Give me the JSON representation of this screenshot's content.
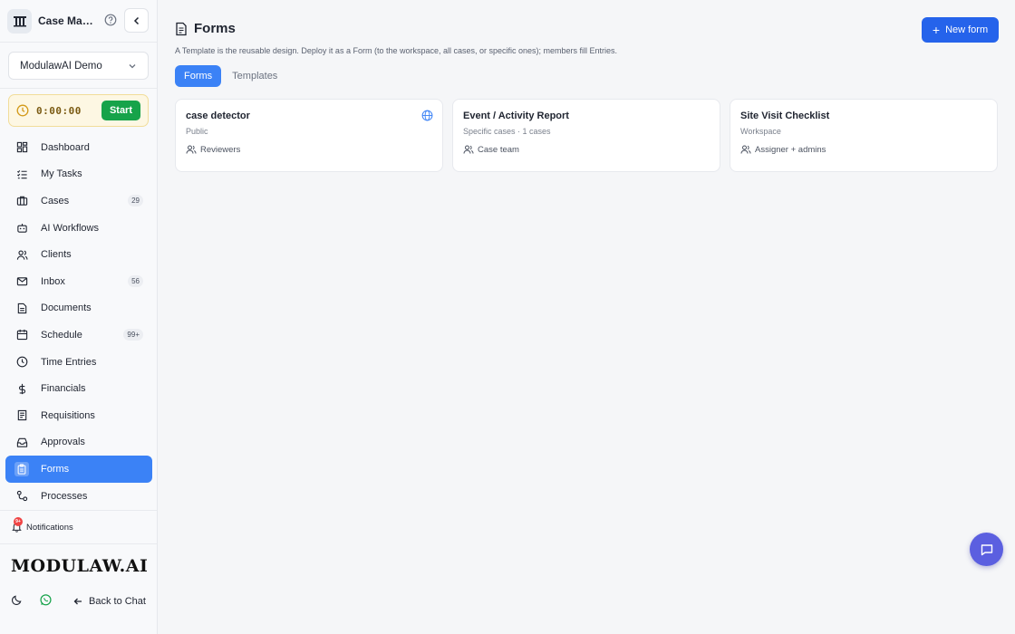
{
  "sidebar": {
    "brand_name": "Case Man...",
    "workspace": "ModulawAI Demo",
    "timer": {
      "time": "0:00:00",
      "start_label": "Start"
    },
    "nav": [
      {
        "label": "Dashboard",
        "icon": "dashboard-icon",
        "badge": ""
      },
      {
        "label": "My Tasks",
        "icon": "tasks-icon",
        "badge": ""
      },
      {
        "label": "Cases",
        "icon": "briefcase-icon",
        "badge": "29"
      },
      {
        "label": "AI Workflows",
        "icon": "robot-icon",
        "badge": ""
      },
      {
        "label": "Clients",
        "icon": "users-icon",
        "badge": ""
      },
      {
        "label": "Inbox",
        "icon": "mail-icon",
        "badge": "56"
      },
      {
        "label": "Documents",
        "icon": "document-icon",
        "badge": ""
      },
      {
        "label": "Schedule",
        "icon": "calendar-icon",
        "badge": "99+"
      },
      {
        "label": "Time Entries",
        "icon": "clock-icon",
        "badge": ""
      },
      {
        "label": "Financials",
        "icon": "dollar-icon",
        "badge": ""
      },
      {
        "label": "Requisitions",
        "icon": "receipt-icon",
        "badge": ""
      },
      {
        "label": "Approvals",
        "icon": "inbox-check-icon",
        "badge": ""
      },
      {
        "label": "Forms",
        "icon": "clipboard-icon",
        "badge": "",
        "active": true
      },
      {
        "label": "Processes",
        "icon": "process-icon",
        "badge": ""
      }
    ],
    "notifications": {
      "label": "Notifications",
      "badge": "9+"
    },
    "wordmark": "MODULAW.AI",
    "back_to_chat": "Back to Chat"
  },
  "main": {
    "title": "Forms",
    "subtitle": "A Template is the reusable design. Deploy it as a Form (to the workspace, all cases, or specific ones); members fill Entries.",
    "new_form_label": "New form",
    "tabs": [
      {
        "label": "Forms",
        "active": true
      },
      {
        "label": "Templates",
        "active": false
      }
    ],
    "cards": [
      {
        "title": "case detector",
        "scope": "Public",
        "audience": "Reviewers",
        "globe": true
      },
      {
        "title": "Event / Activity Report",
        "scope": "Specific cases · 1 cases",
        "audience": "Case team",
        "globe": false
      },
      {
        "title": "Site Visit Checklist",
        "scope": "Workspace",
        "audience": "Assigner + admins",
        "globe": false
      }
    ]
  },
  "colors": {
    "accent": "#3b82f6",
    "primary_button": "#2563eb",
    "timer_start": "#16a34a",
    "chat_fab": "#5b5fe0",
    "notification_badge": "#ef4444"
  }
}
